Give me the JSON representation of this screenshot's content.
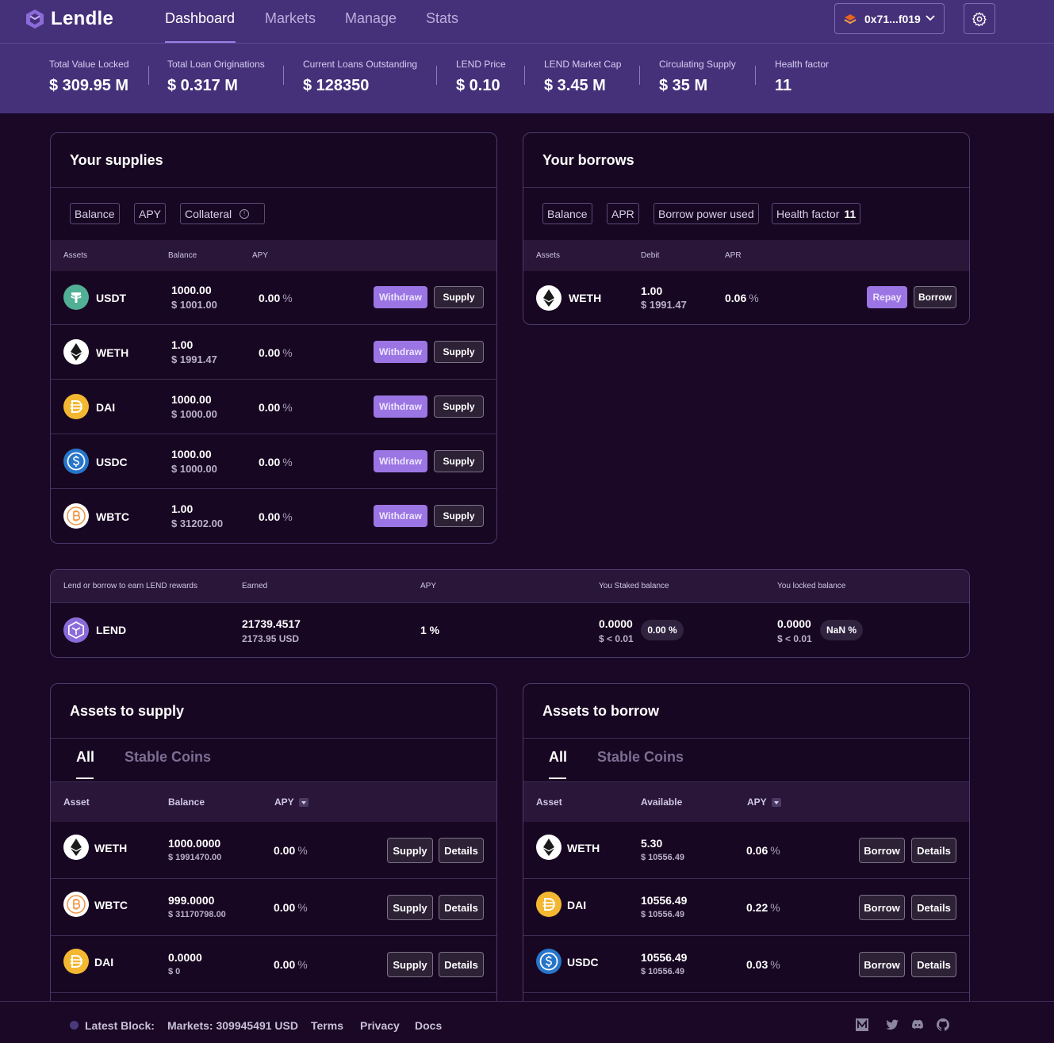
{
  "app": {
    "name": "Lendle"
  },
  "nav": {
    "links": [
      "Dashboard",
      "Markets",
      "Manage",
      "Stats"
    ],
    "active": "Dashboard",
    "wallet_address": "0x71...f019"
  },
  "stats": [
    {
      "label": "Total Value Locked",
      "value": "$ 309.95 M"
    },
    {
      "label": "Total Loan Originations",
      "value": "$ 0.317 M"
    },
    {
      "label": "Current Loans Outstanding",
      "value": "$ 128350"
    },
    {
      "label": "LEND Price",
      "value": "$ 0.10"
    },
    {
      "label": "LEND Market Cap",
      "value": "$ 3.45 M"
    },
    {
      "label": "Circulating Supply",
      "value": "$ 35 M"
    },
    {
      "label": "Health factor",
      "value": "11"
    }
  ],
  "supplies": {
    "title": "Your supplies",
    "chips": [
      "Balance",
      "APY",
      "Collateral"
    ],
    "info_glyph": "!",
    "headers": [
      "Assets",
      "Balance",
      "APY"
    ],
    "withdraw_label": "Withdraw",
    "supply_label": "Supply",
    "rows": [
      {
        "symbol": "USDT",
        "balance": "1000.00",
        "usd": "$ 1001.00",
        "apy": "0.00",
        "unit": "%"
      },
      {
        "symbol": "WETH",
        "balance": "1.00",
        "usd": "$ 1991.47",
        "apy": "0.00",
        "unit": "%"
      },
      {
        "symbol": "DAI",
        "balance": "1000.00",
        "usd": "$ 1000.00",
        "apy": "0.00",
        "unit": "%"
      },
      {
        "symbol": "USDC",
        "balance": "1000.00",
        "usd": "$ 1000.00",
        "apy": "0.00",
        "unit": "%"
      },
      {
        "symbol": "WBTC",
        "balance": "1.00",
        "usd": "$ 31202.00",
        "apy": "0.00",
        "unit": "%"
      }
    ]
  },
  "borrows": {
    "title": "Your borrows",
    "chips": [
      "Balance",
      "APR",
      "Borrow power used"
    ],
    "health_label": "Health factor",
    "health_value": "11",
    "headers": [
      "Assets",
      "Debit",
      "APR"
    ],
    "repay_label": "Repay",
    "borrow_label": "Borrow",
    "rows": [
      {
        "symbol": "WETH",
        "debit": "1.00",
        "usd": "$ 1991.47",
        "apr": "0.06",
        "unit": "%"
      }
    ]
  },
  "rewards": {
    "headers": [
      "Lend or borrow to earn LEND rewards",
      "Earned",
      "APY",
      "You Staked balance",
      "You locked balance"
    ],
    "token": "LEND",
    "earned": "21739.4517",
    "earned_usd": "2173.95 USD",
    "apy": "1 %",
    "staked": "0.0000",
    "staked_usd": "$ < 0.01",
    "staked_pill": "0.00 %",
    "locked": "0.0000",
    "locked_usd": "$ < 0.01",
    "locked_pill": "NaN %"
  },
  "assets_supply": {
    "title": "Assets to supply",
    "tabs": [
      "All",
      "Stable Coins"
    ],
    "headers": [
      "Asset",
      "Balance",
      "APY"
    ],
    "supply_label": "Supply",
    "details_label": "Details",
    "rows": [
      {
        "symbol": "WETH",
        "balance": "1000.0000",
        "usd": "$ 1991470.00",
        "apy": "0.00",
        "unit": "%"
      },
      {
        "symbol": "WBTC",
        "balance": "999.0000",
        "usd": "$ 31170798.00",
        "apy": "0.00",
        "unit": "%"
      },
      {
        "symbol": "DAI",
        "balance": "0.0000",
        "usd": "$ 0",
        "apy": "0.00",
        "unit": "%"
      }
    ]
  },
  "assets_borrow": {
    "title": "Assets to borrow",
    "tabs": [
      "All",
      "Stable Coins"
    ],
    "headers": [
      "Asset",
      "Available",
      "APY"
    ],
    "borrow_label": "Borrow",
    "details_label": "Details",
    "rows": [
      {
        "symbol": "WETH",
        "available": "5.30",
        "usd": "$ 10556.49",
        "apy": "0.06",
        "unit": "%"
      },
      {
        "symbol": "DAI",
        "available": "10556.49",
        "usd": "$ 10556.49",
        "apy": "0.22",
        "unit": "%"
      },
      {
        "symbol": "USDC",
        "available": "10556.49",
        "usd": "$ 10556.49",
        "apy": "0.03",
        "unit": "%"
      }
    ]
  },
  "footer": {
    "latest_block": "Latest Block:",
    "markets": "Markets: 309945491 USD",
    "links": [
      "Terms",
      "Privacy",
      "Docs"
    ],
    "social_icons": [
      "medium-icon",
      "twitter-icon",
      "discord-icon",
      "github-icon"
    ]
  },
  "colors": {
    "header_bg": "#45317a",
    "page_bg": "#1a0826",
    "accent": "#9b75e3",
    "usdt": "#50af95",
    "dai": "#f4b731",
    "usdc": "#2775ca",
    "wbtc_ring": "#f09242"
  }
}
